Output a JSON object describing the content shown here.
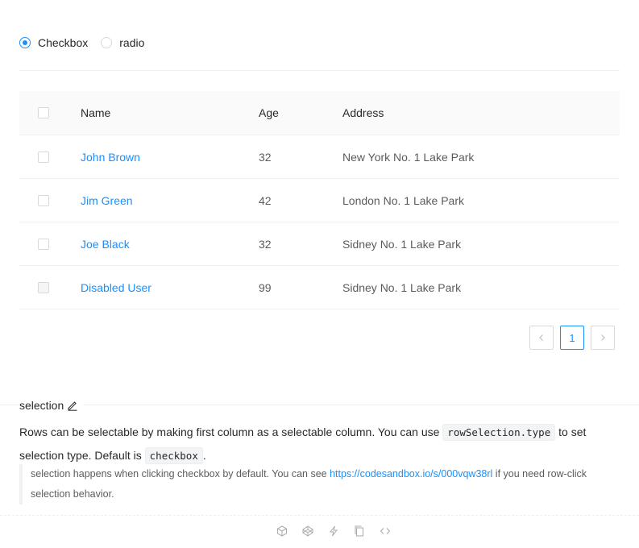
{
  "selection_type": {
    "options": [
      {
        "label": "Checkbox",
        "checked": true
      },
      {
        "label": "radio",
        "checked": false
      }
    ]
  },
  "table": {
    "columns": [
      "Name",
      "Age",
      "Address"
    ],
    "rows": [
      {
        "name": "John Brown",
        "age": "32",
        "address": "New York No. 1 Lake Park",
        "disabled": false
      },
      {
        "name": "Jim Green",
        "age": "42",
        "address": "London No. 1 Lake Park",
        "disabled": false
      },
      {
        "name": "Joe Black",
        "age": "32",
        "address": "Sidney No. 1 Lake Park",
        "disabled": false
      },
      {
        "name": "Disabled User",
        "age": "99",
        "address": "Sidney No. 1 Lake Park",
        "disabled": true
      }
    ]
  },
  "pagination": {
    "prev_icon": "chevron-left-icon",
    "current_page": "1",
    "next_icon": "chevron-right-icon"
  },
  "description": {
    "title": "selection",
    "text_part1": "Rows can be selectable by making first column as a selectable column. You can use ",
    "code1": "rowSelection.type",
    "text_part2": " to set selection type. Default is ",
    "code2": "checkbox",
    "text_part3": ".",
    "note_part1": "selection happens when clicking checkbox by default. You can see ",
    "note_link": "https://codesandbox.io/s/000vqw38rl",
    "note_part2": " if you need row-click selection behavior."
  },
  "actions": [
    "codesandbox-icon",
    "codepen-icon",
    "stackblitz-icon",
    "copy-icon",
    "code-expand-icon"
  ],
  "colors": {
    "primary": "#1890ff",
    "border": "#d9d9d9",
    "header_bg": "#fafafa"
  }
}
